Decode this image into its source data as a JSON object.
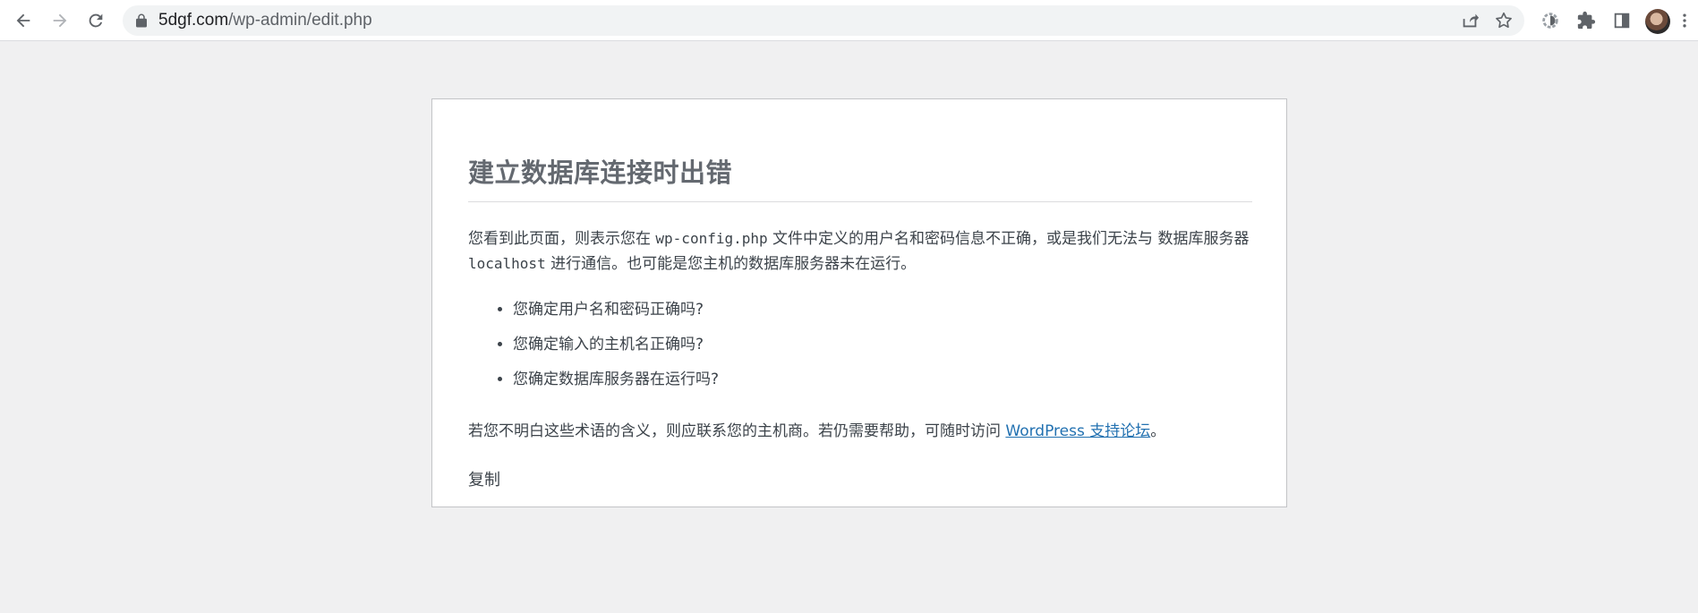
{
  "browser": {
    "url_host": "5dgf.com",
    "url_path": "/wp-admin/edit.php"
  },
  "error": {
    "title": "建立数据库连接时出错",
    "intro_part1": "您看到此页面，则表示您在 ",
    "config_file": "wp-config.php",
    "intro_part2": " 文件中定义的用户名和密码信息不正确，或是我们无法与 数据库服务器 ",
    "db_host": "localhost",
    "intro_part3": " 进行通信。也可能是您主机的数据库服务器未在运行。",
    "checks": [
      "您确定用户名和密码正确吗?",
      "您确定输入的主机名正确吗?",
      "您确定数据库服务器在运行吗?"
    ],
    "help_text": "若您不明白这些术语的含义，则应联系您的主机商。若仍需要帮助，可随时访问 ",
    "help_link": "WordPress 支持论坛",
    "help_end": "。",
    "copy_label": "复制"
  }
}
